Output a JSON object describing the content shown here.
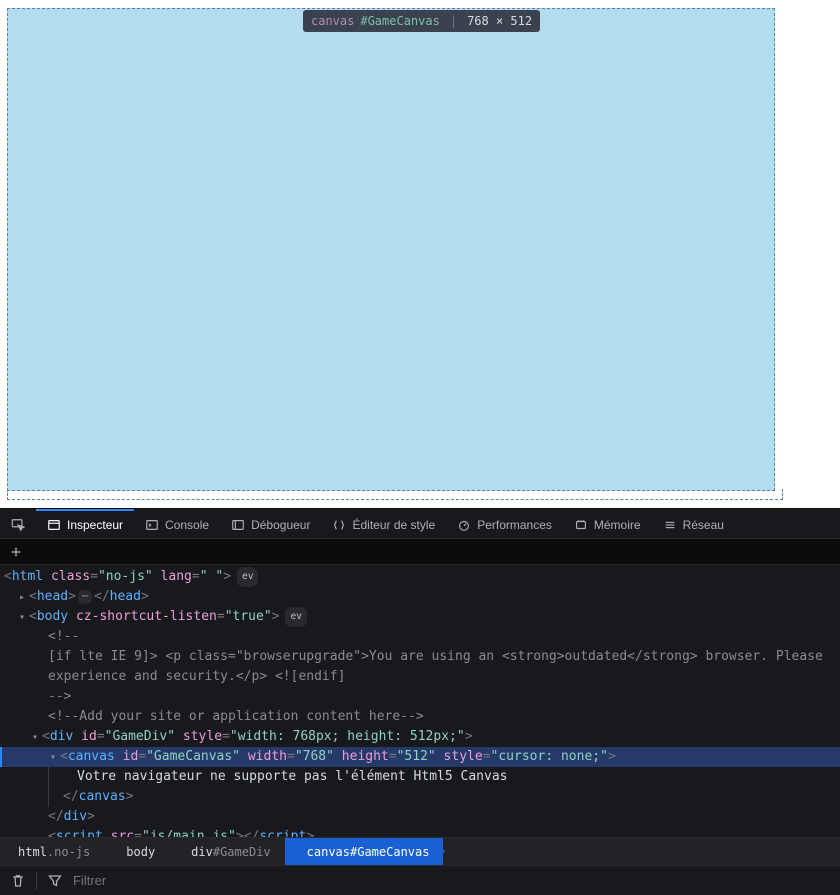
{
  "tooltip": {
    "tag": "canvas",
    "id": "#GameCanvas",
    "dimensions": "768 × 512"
  },
  "tabs": {
    "inspector": "Inspecteur",
    "console": "Console",
    "debugger": "Débogueur",
    "style_editor": "Éditeur de style",
    "performance": "Performances",
    "memory": "Mémoire",
    "network": "Réseau"
  },
  "dom": {
    "html_line": "<html class=\"no-js\" lang=\" \"> ev",
    "head_open": "<head>",
    "head_close": "</head>",
    "body_open_pre": "<body ",
    "body_attr": "cz-shortcut-listen",
    "body_val": "\"true\"",
    "body_close": ">",
    "ev": "ev",
    "c1": "<!--",
    "c2": "[if lte IE 9]> <p class=\"browserupgrade\">You are using an <strong>outdated</strong> browser. Please",
    "c3": "experience and security.</p> <![endif]",
    "c4": "-->",
    "c5": "<!--Add your site or application content here-->",
    "gamediv_open_pre": "<div ",
    "gamediv_id_attr": "id",
    "gamediv_id_val": "\"GameDiv\"",
    "gamediv_style_attr": "style",
    "gamediv_style_val": "\"width: 768px; height: 512px;\"",
    "canvas_open_pre": "<canvas ",
    "canvas_id_val": "\"GameCanvas\"",
    "canvas_w_attr": "width",
    "canvas_w_val": "\"768\"",
    "canvas_h_attr": "height",
    "canvas_h_val": "\"512\"",
    "canvas_style_val": "\"cursor: none;\"",
    "canvas_text": "Votre navigateur ne supporte pas l'élément Html5 Canvas",
    "canvas_close": "</canvas>",
    "div_close": "</div>",
    "script_open_pre": "<script ",
    "script_src_attr": "src",
    "script_src_val": "\"js/main.js\"",
    "script_close_inline": "></script>"
  },
  "breadcrumbs": {
    "b1_main": "html",
    "b1_muted": ".no-js",
    "b2": "body",
    "b3_main": "div",
    "b3_muted": "#GameDiv",
    "b4": "canvas#GameCanvas"
  },
  "filter": {
    "placeholder": "Filtrer"
  }
}
